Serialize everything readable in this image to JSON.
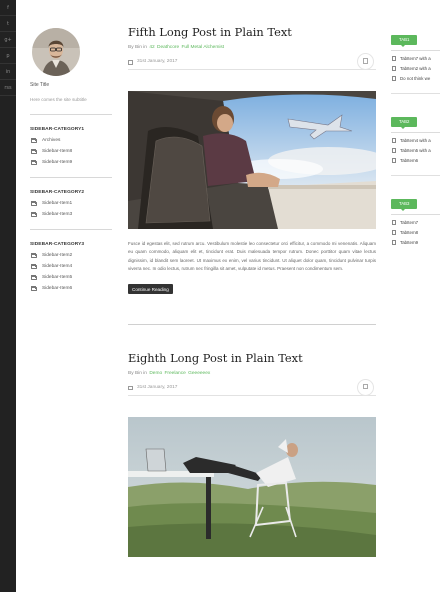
{
  "social": {
    "icons": [
      "f",
      "t",
      "g+",
      "p",
      "in",
      "rss"
    ]
  },
  "profile": {
    "site_title": "Site Title",
    "site_subtitle": "Here comes the site subtitle"
  },
  "categories": [
    {
      "heading": "SIDEBAR-CATEGORY1",
      "items": [
        "Archives",
        "Sidebar-Item8",
        "Sidebar-Item9"
      ]
    },
    {
      "heading": "SIDEBAR-CATEGORY2",
      "items": [
        "Sidebar-Item1",
        "Sidebar-Item3"
      ]
    },
    {
      "heading": "SIDEBAR-CATEGORY3",
      "items": [
        "Sidebar-Item2",
        "Sidebar-Item4",
        "Sidebar-Item5",
        "Sidebar-Item6"
      ]
    }
  ],
  "posts": [
    {
      "title": "Fifth Long Post in Plain Text",
      "by": "By",
      "author": "Bin",
      "in": "in",
      "cats": [
        "42",
        "Deathcore",
        "Full Metal Alchemist"
      ],
      "date": "31st January, 2017",
      "excerpt": "Fusce id egestas elit, sed rutrum arcu. Vestibulum molestie leo consectetur orci efficitur, a commodo mi venenatis. Aliquam eu quam commodo, aliquam elit et, tincidunt erat. Duis malesuada tempor rutrum. Donec porttitor quam vitae lectus dignissim, id blandit sem laoreet. Ut maximus ex enim, vel varius tincidunt. Ut aliquet dolor quam, tincidunt pulvinar turpis viverra nec. In odio lectus, rutrum nec fringilla sit amet, vulputate id metus. Praesent non condimentum sem.",
      "read_more": "Continue Reading"
    },
    {
      "title": "Eighth Long Post in Plain Text",
      "by": "By",
      "author": "Bin",
      "in": "in",
      "cats": [
        "Demo",
        "Freelance",
        "Geeeeeex"
      ],
      "date": "31st January, 2017"
    }
  ],
  "tabs": [
    {
      "label": "TAB1",
      "items": [
        "TabItem7 with a",
        "TabItem2 with a",
        "Do not think we"
      ]
    },
    {
      "label": "TAB2",
      "items": [
        "TabItem4 with a",
        "TabItem5 with a",
        "TabItem6"
      ]
    },
    {
      "label": "TAB3",
      "items": [
        "TabItem7",
        "TabItem8",
        "TabItem9"
      ]
    }
  ],
  "colors": {
    "accent": "#5cb85c",
    "dark_bar": "#222222",
    "button": "#333333"
  }
}
